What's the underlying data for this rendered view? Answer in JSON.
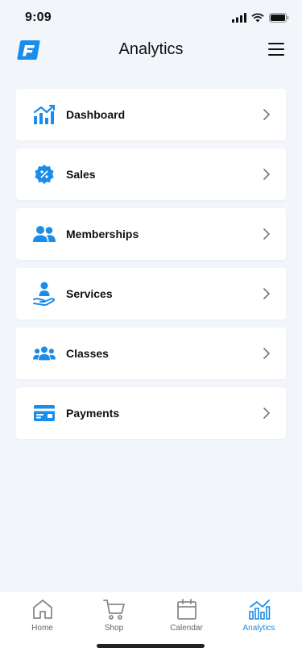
{
  "status": {
    "time": "9:09"
  },
  "header": {
    "title": "Analytics"
  },
  "menu": [
    {
      "label": "Dashboard",
      "icon": "chart-icon"
    },
    {
      "label": "Sales",
      "icon": "sales-badge-icon"
    },
    {
      "label": "Memberships",
      "icon": "members-icon"
    },
    {
      "label": "Services",
      "icon": "service-hand-icon"
    },
    {
      "label": "Classes",
      "icon": "group-icon"
    },
    {
      "label": "Payments",
      "icon": "card-icon"
    }
  ],
  "tabs": [
    {
      "label": "Home",
      "icon": "home-icon",
      "active": false
    },
    {
      "label": "Shop",
      "icon": "cart-icon",
      "active": false
    },
    {
      "label": "Calendar",
      "icon": "calendar-icon",
      "active": false
    },
    {
      "label": "Analytics",
      "icon": "analytics-icon",
      "active": true
    }
  ],
  "colors": {
    "accent": "#1A8DEB",
    "background": "#F2F5FA"
  }
}
